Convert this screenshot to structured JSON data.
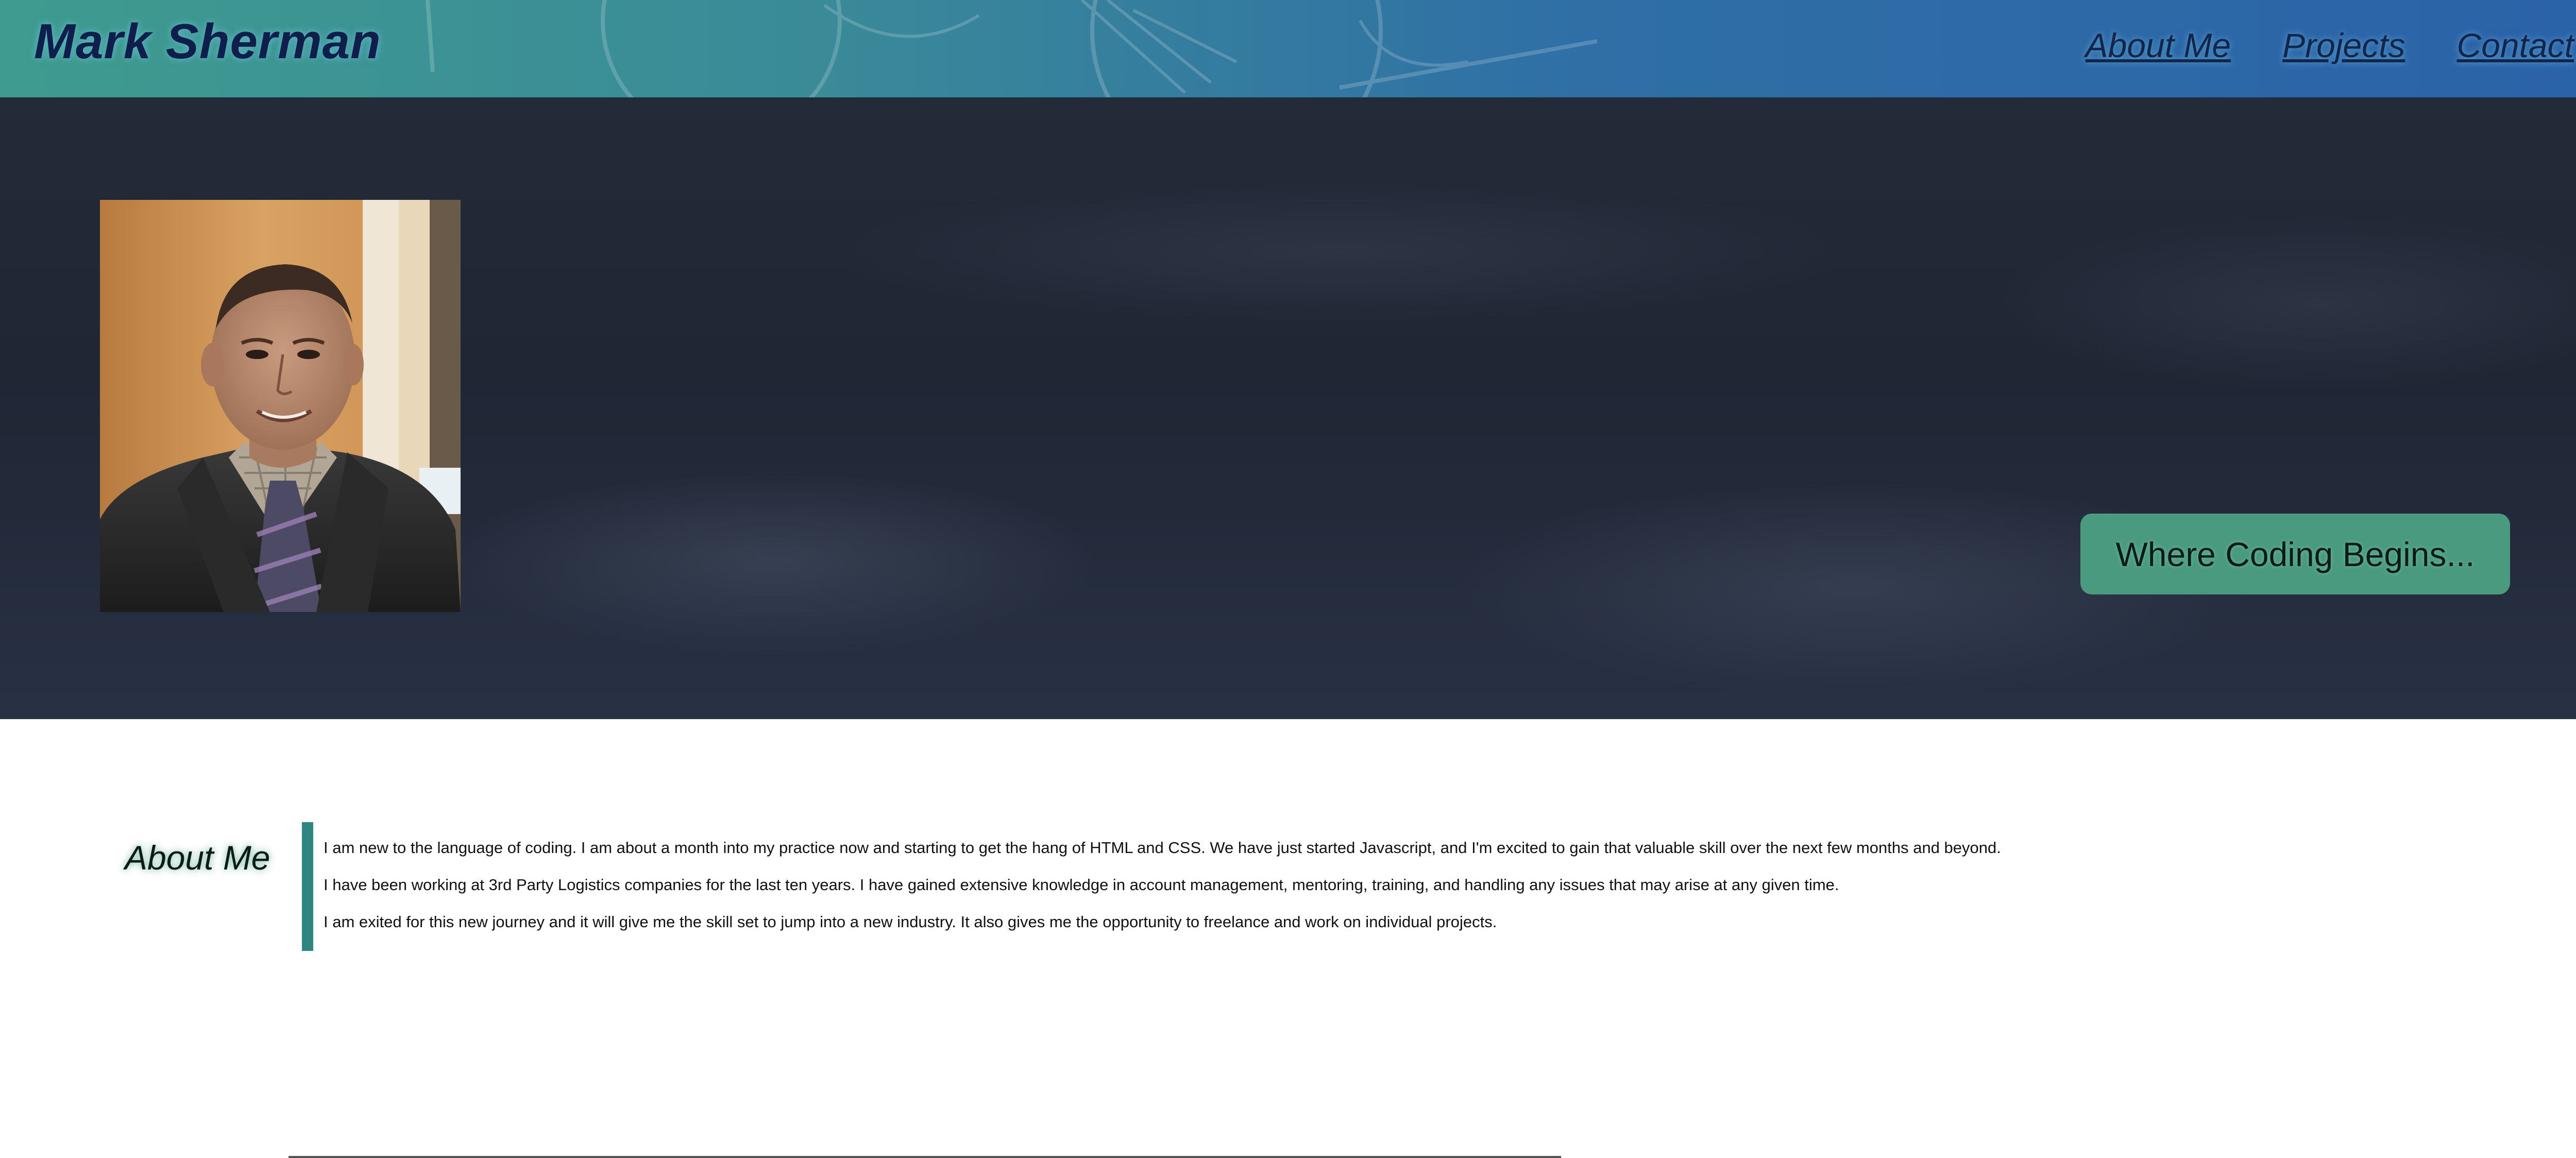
{
  "header": {
    "site_title": "Mark Sherman",
    "nav": [
      "About Me",
      "Projects",
      "Contact"
    ]
  },
  "hero": {
    "photo_icon": "profile-photo",
    "tagline": "Where Coding Begins..."
  },
  "about": {
    "heading": "About Me",
    "paragraphs": [
      "I am new to the language of coding. I am about a month into my practice now and starting to get the hang of HTML and CSS. We have just started Javascript, and I'm excited to gain that valuable skill over the next few months and beyond.",
      "I have been working at 3rd Party Logistics companies for the last ten years. I have gained extensive knowledge in account management, mentoring, training, and handling any issues that may arise at any given time.",
      "I am exited for this new journey and it will give me the skill set to jump into a new industry. It also gives me the opportunity to freelance and work on individual projects."
    ]
  },
  "colors": {
    "header_start": "#3f9b8f",
    "header_end": "#2b62a8",
    "hero_bg": "#1f2634",
    "accent_green": "#4a9a7f",
    "about_bar": "#2f8580"
  }
}
